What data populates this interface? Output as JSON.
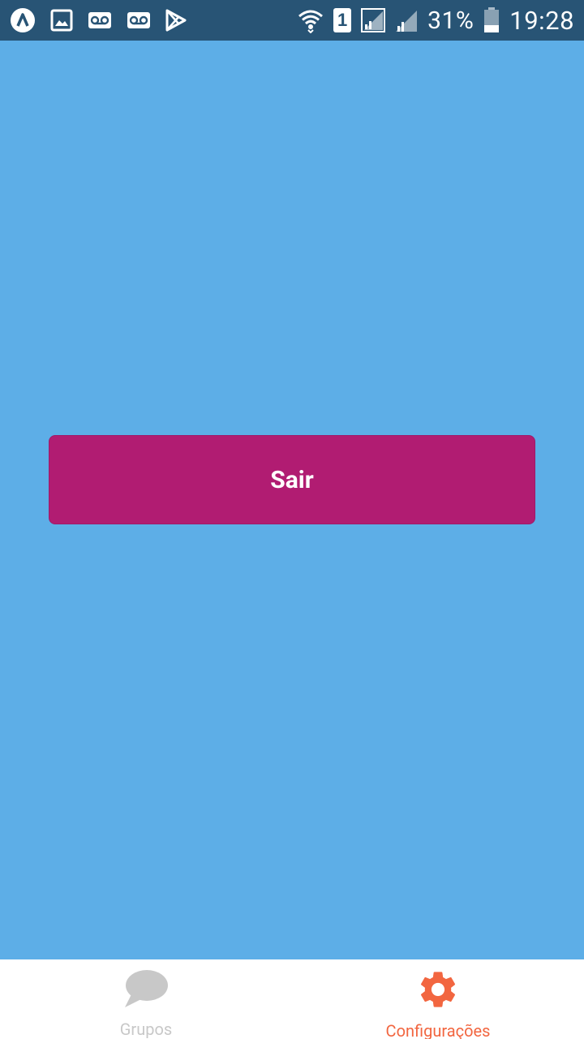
{
  "status_bar": {
    "icons_left": [
      "android-studio-icon",
      "image-icon",
      "voicemail-icon",
      "voicemail-icon",
      "play-store-icon"
    ],
    "sim_slot": "1",
    "battery_text": "31%",
    "time": "19:28"
  },
  "main": {
    "logout_label": "Sair",
    "background_color": "#5DAEE7",
    "button_color": "#B11C72"
  },
  "bottom_nav": {
    "tabs": [
      {
        "label": "Grupos",
        "icon": "chat-bubble-icon",
        "active": false,
        "color": "#C8C8C8"
      },
      {
        "label": "Configurações",
        "icon": "gear-icon",
        "active": true,
        "color": "#F26640"
      }
    ]
  }
}
